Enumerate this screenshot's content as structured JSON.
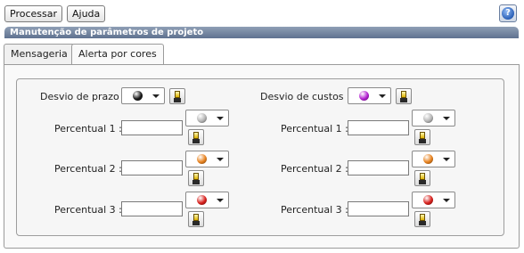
{
  "toolbar": {
    "process_label": "Processar",
    "help_label": "Ajuda",
    "help_icon_glyph": "?"
  },
  "panel": {
    "title": "Manutenção de parâmetros de projeto"
  },
  "tabs": [
    {
      "label": "Mensageria",
      "active": false
    },
    {
      "label": "Alerta por cores",
      "active": true
    }
  ],
  "deadline": {
    "label": "Desvio de prazo :",
    "main_color": "#1a1a1a",
    "percentuals": [
      {
        "label": "Percentual 1 :",
        "value": "",
        "color": "#b5b5b5"
      },
      {
        "label": "Percentual 2 :",
        "value": "",
        "color": "#e8821e"
      },
      {
        "label": "Percentual 3 :",
        "value": "",
        "color": "#d8201c"
      }
    ]
  },
  "cost": {
    "label": "Desvio de custos :",
    "main_color": "#b31fd1",
    "percentuals": [
      {
        "label": "Percentual 1 :",
        "value": "",
        "color": "#b5b5b5"
      },
      {
        "label": "Percentual 2 :",
        "value": "",
        "color": "#e8821e"
      },
      {
        "label": "Percentual 3 :",
        "value": "",
        "color": "#d8201c"
      }
    ]
  },
  "icons": {
    "color_picker": "color-swatch-icon",
    "brush": "paint-brush-icon",
    "help": "help-icon"
  }
}
